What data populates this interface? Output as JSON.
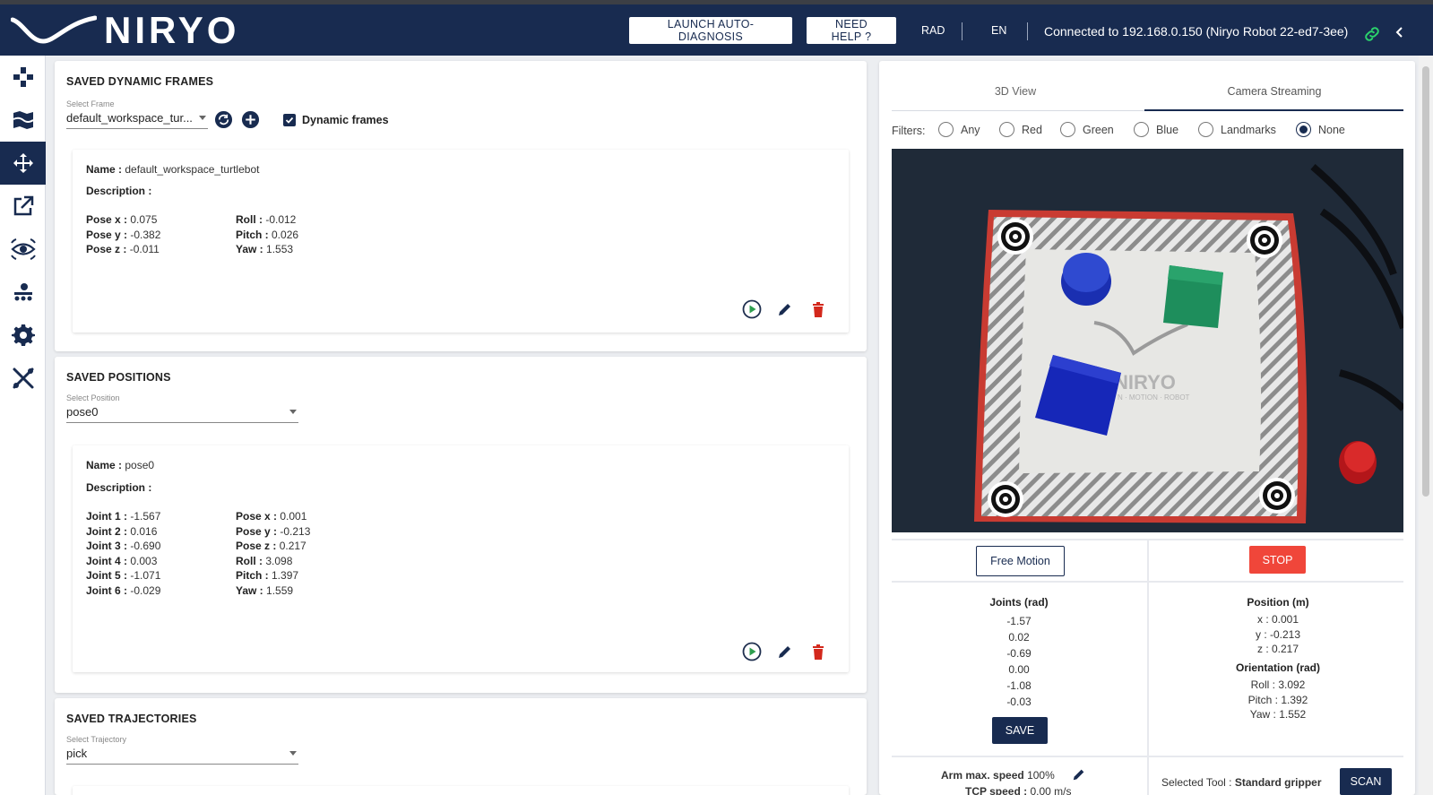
{
  "header": {
    "brand": "NIRYO",
    "launch_btn": "LAUNCH AUTO-DIAGNOSIS",
    "help_btn": "NEED HELP ?",
    "unit": "RAD",
    "lang": "EN",
    "connection": "Connected to 192.168.0.150 (Niryo Robot 22-ed7-3ee)"
  },
  "sidebar": {
    "items": [
      {
        "icon": "joystick-icon"
      },
      {
        "icon": "map-icon"
      },
      {
        "icon": "move-arrows-icon",
        "active": true
      },
      {
        "icon": "external-link-icon"
      },
      {
        "icon": "eye-icon"
      },
      {
        "icon": "conveyor-icon"
      },
      {
        "icon": "gear-icon"
      },
      {
        "icon": "tools-icon"
      }
    ]
  },
  "frames": {
    "title": "SAVED DYNAMIC FRAMES",
    "select_label": "Select Frame",
    "selected": "default_workspace_tur...",
    "checkbox_label": "Dynamic frames",
    "name_label": "Name :",
    "name_value": "default_workspace_turtlebot",
    "desc_label": "Description :",
    "fields_left": [
      {
        "k": "Pose x :",
        "v": "0.075"
      },
      {
        "k": "Pose y :",
        "v": "-0.382"
      },
      {
        "k": "Pose z :",
        "v": "-0.011"
      }
    ],
    "fields_right": [
      {
        "k": "Roll :",
        "v": "-0.012"
      },
      {
        "k": "Pitch :",
        "v": "0.026"
      },
      {
        "k": "Yaw :",
        "v": "1.553"
      }
    ]
  },
  "positions": {
    "title": "SAVED POSITIONS",
    "select_label": "Select Position",
    "selected": "pose0",
    "name_label": "Name :",
    "name_value": "pose0",
    "desc_label": "Description :",
    "fields_left": [
      {
        "k": "Joint 1 :",
        "v": "-1.567"
      },
      {
        "k": "Joint 2 :",
        "v": "0.016"
      },
      {
        "k": "Joint 3 :",
        "v": "-0.690"
      },
      {
        "k": "Joint 4 :",
        "v": "0.003"
      },
      {
        "k": "Joint 5 :",
        "v": "-1.071"
      },
      {
        "k": "Joint 6 :",
        "v": "-0.029"
      }
    ],
    "fields_right": [
      {
        "k": "Pose x :",
        "v": "0.001"
      },
      {
        "k": "Pose y :",
        "v": "-0.213"
      },
      {
        "k": "Pose z :",
        "v": "0.217"
      },
      {
        "k": "Roll :",
        "v": "3.098"
      },
      {
        "k": "Pitch :",
        "v": "1.397"
      },
      {
        "k": "Yaw :",
        "v": "1.559"
      }
    ]
  },
  "trajectories": {
    "title": "SAVED TRAJECTORIES",
    "select_label": "Select Trajectory",
    "selected": "pick"
  },
  "view": {
    "tabs": [
      "3D View",
      "Camera Streaming"
    ],
    "active_tab": 1,
    "filters_label": "Filters:",
    "filters": [
      "Any",
      "Red",
      "Green",
      "Blue",
      "Landmarks",
      "None"
    ],
    "selected_filter": "None",
    "camera_logo": "NIRYO",
    "camera_sub": "N · MOTION · ROBOT"
  },
  "controls": {
    "free_motion": "Free Motion",
    "stop": "STOP",
    "joints_title": "Joints (rad)",
    "joints": [
      "-1.57",
      "0.02",
      "-0.69",
      "0.00",
      "-1.08",
      "-0.03"
    ],
    "save": "SAVE",
    "position_title": "Position (m)",
    "position": [
      {
        "k": "x :",
        "v": "0.001"
      },
      {
        "k": "y :",
        "v": "-0.213"
      },
      {
        "k": "z :",
        "v": "0.217"
      }
    ],
    "orientation_title": "Orientation (rad)",
    "orientation": [
      {
        "k": "Roll :",
        "v": "3.092"
      },
      {
        "k": "Pitch :",
        "v": "1.392"
      },
      {
        "k": "Yaw :",
        "v": "1.552"
      }
    ],
    "arm_speed_label": "Arm max. speed",
    "arm_speed_value": "100%",
    "tcp_speed_label": "TCP speed :",
    "tcp_speed_value": "0.00 m/s",
    "tool_label": "Selected Tool :",
    "tool_value": "Standard gripper",
    "scan": "SCAN"
  },
  "colors": {
    "navy": "#182b50",
    "stop_red": "#f0463a",
    "play_green": "#2e9e4f",
    "delete_red": "#d3281c"
  }
}
